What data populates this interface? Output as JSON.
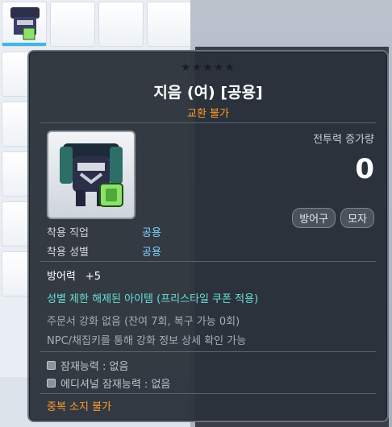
{
  "tooltip": {
    "stars": "★★★★★",
    "name": "지음 (여) [공용]",
    "trade_note": "교환 불가",
    "power_label": "전투력 증가량",
    "power_value": "0",
    "categories": [
      "방어구",
      "모자"
    ],
    "requirements": [
      {
        "label": "착용 직업",
        "value": "공용"
      },
      {
        "label": "착용 성별",
        "value": "공용"
      }
    ],
    "stat": {
      "label": "방어력",
      "bonus": "+5"
    },
    "gender_note": "성별 제한 해제된 아이템 (프리스타일 쿠폰 적용)",
    "enhance_line": "주문서 강화 없음 (잔여 7회, 복구 가능 0회)",
    "npc_line": "NPC/채집키를 통해 강화 정보 상세 확인 가능",
    "potential": "잠재능력 : 없음",
    "additional_potential": "에디셔널 잠재능력 : 없음",
    "duplicate_note": "중복 소지 불가"
  },
  "colors": {
    "accent_orange": "#ff9a2a",
    "value_blue": "#7fd3ff",
    "note_cyan": "#66e0d8"
  }
}
